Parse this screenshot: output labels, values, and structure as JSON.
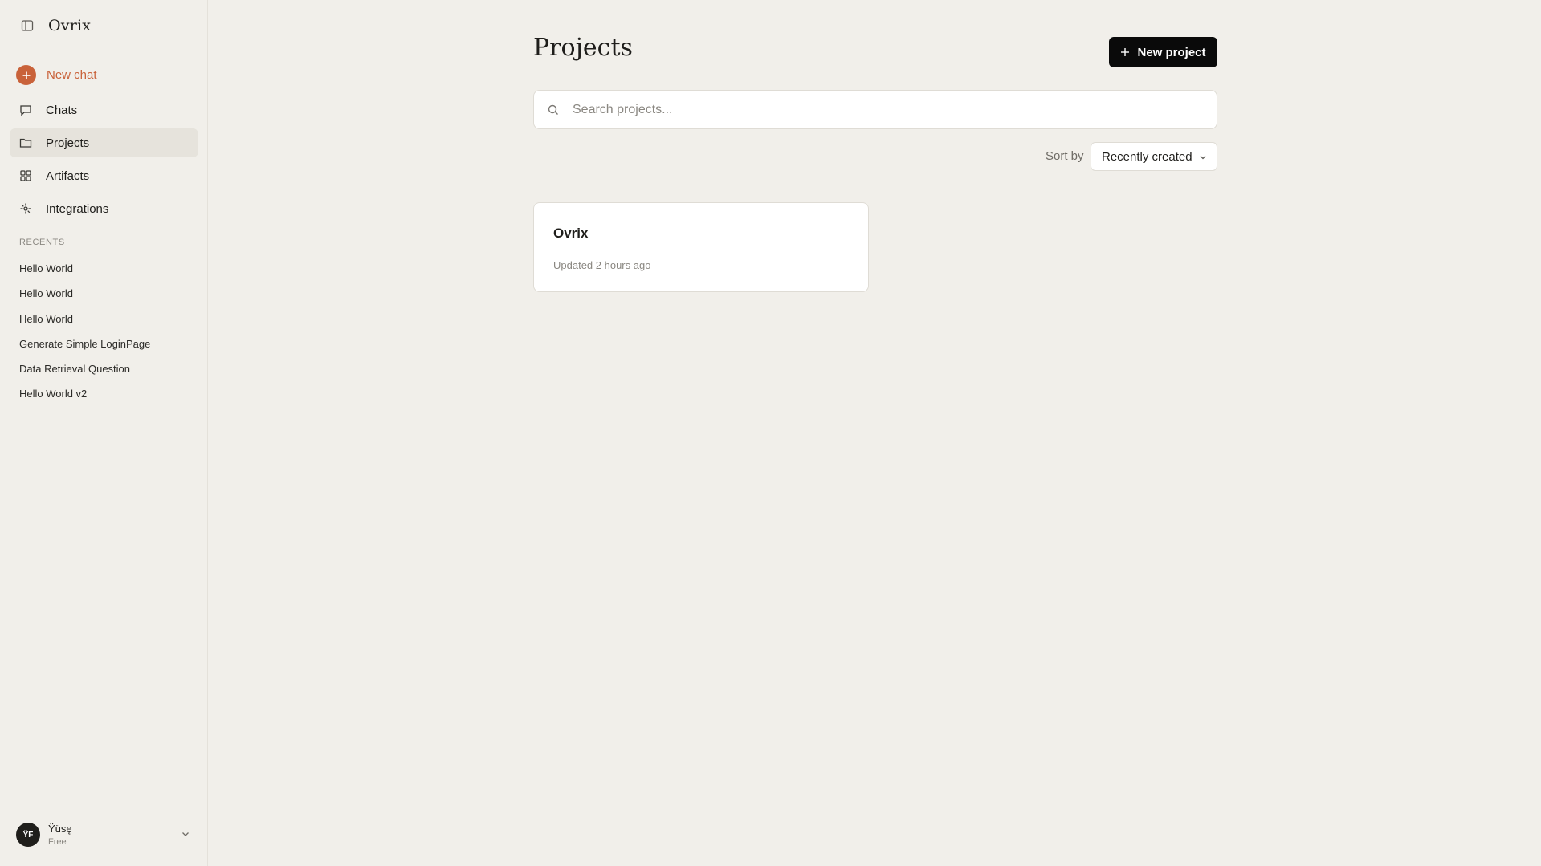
{
  "app": {
    "name": "Ovrix"
  },
  "sidebar": {
    "new_chat_label": "New chat",
    "nav": [
      {
        "label": "Chats",
        "icon": "chat-bubble-icon"
      },
      {
        "label": "Projects",
        "icon": "folder-icon",
        "active": true
      },
      {
        "label": "Artifacts",
        "icon": "grid-icon"
      },
      {
        "label": "Integrations",
        "icon": "integrations-icon"
      }
    ],
    "recents_title": "RECENTS",
    "recents": [
      "Hello World",
      "Hello World",
      "Hello World",
      "Generate Simple LoginPage",
      "Data Retrieval Question",
      "Hello World v2"
    ],
    "user": {
      "initials": "ŸF",
      "name": "Ÿüsę",
      "plan": "Free"
    }
  },
  "main": {
    "title": "Projects",
    "new_project_label": "New project",
    "search": {
      "placeholder": "Search projects...",
      "value": ""
    },
    "sort": {
      "label": "Sort by",
      "value": "Recently created"
    },
    "projects": [
      {
        "name": "Ovrix",
        "updated": "Updated 2 hours ago"
      }
    ]
  },
  "colors": {
    "background": "#f1efea",
    "accent": "#c9623a",
    "primary_button": "#0a0a0a",
    "active_nav": "#e6e3dc"
  }
}
